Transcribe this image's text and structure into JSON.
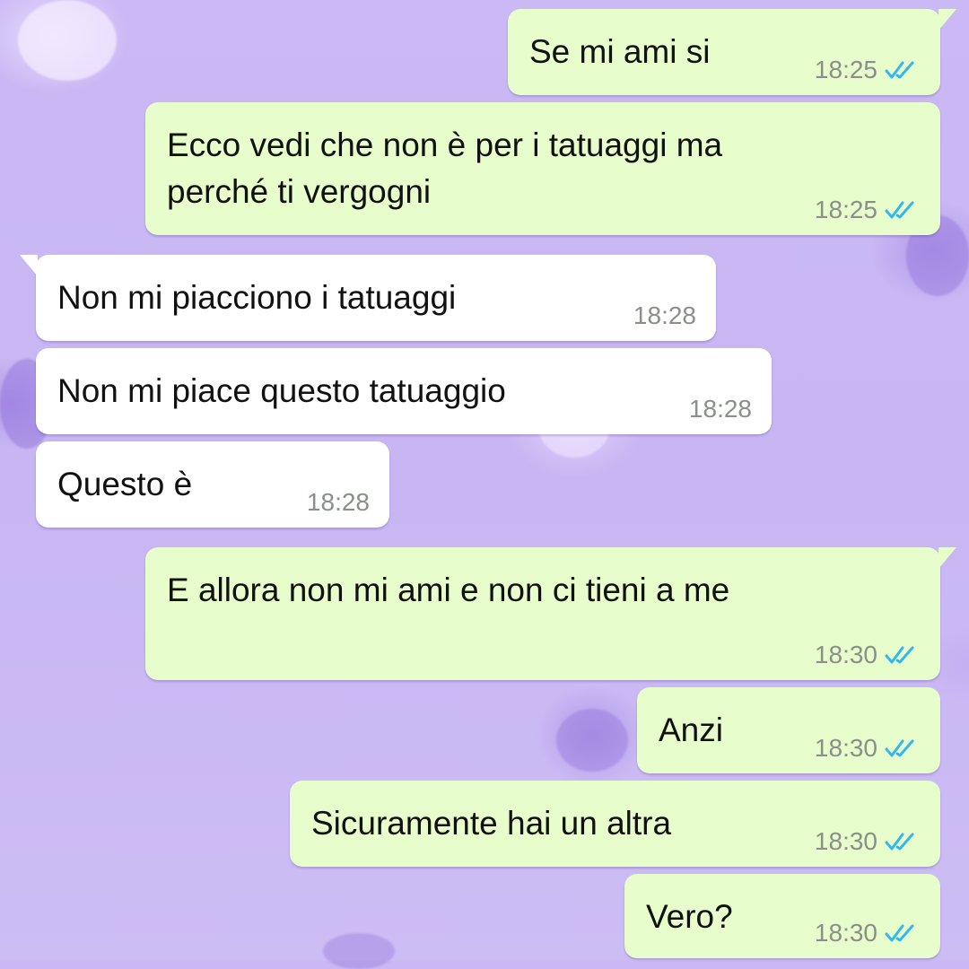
{
  "conversation": {
    "messages": [
      {
        "direction": "out",
        "text": "Se mi ami si",
        "time": "18:25",
        "status": "read"
      },
      {
        "direction": "out",
        "text": "Ecco vedi che non è per i tatuaggi ma\nperché ti vergogni",
        "time": "18:25",
        "status": "read"
      },
      {
        "direction": "in",
        "text": "Non mi piacciono i tatuaggi",
        "time": "18:28"
      },
      {
        "direction": "in",
        "text": "Non mi piace questo tatuaggio",
        "time": "18:28"
      },
      {
        "direction": "in",
        "text": "Questo è",
        "time": "18:28"
      },
      {
        "direction": "out",
        "text": "E allora non mi ami e non ci tieni a me",
        "time": "18:30",
        "status": "read"
      },
      {
        "direction": "out",
        "text": "Anzi",
        "time": "18:30",
        "status": "read"
      },
      {
        "direction": "out",
        "text": "Sicuramente hai un altra",
        "time": "18:30",
        "status": "read"
      },
      {
        "direction": "out",
        "text": "Vero?",
        "time": "18:30",
        "status": "read"
      }
    ]
  },
  "colors": {
    "outgoing_bubble": "#e7fdcc",
    "incoming_bubble": "#ffffff",
    "read_ticks": "#34b7f1",
    "wallpaper": "#c9b8f3"
  },
  "icons": {
    "read_receipt": "double-check-icon"
  }
}
